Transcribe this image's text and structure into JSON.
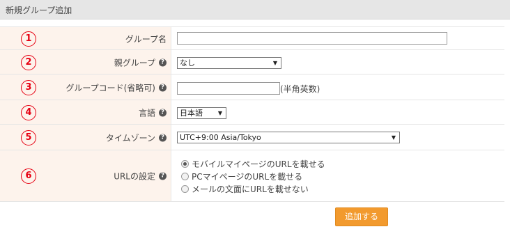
{
  "header": {
    "title": "新規グループ追加"
  },
  "rows": [
    {
      "num": "1",
      "label": "グループ名",
      "help": false,
      "value": ""
    },
    {
      "num": "2",
      "label": "親グループ",
      "help": true,
      "selected": "なし"
    },
    {
      "num": "3",
      "label": "グループコード(省略可)",
      "help": true,
      "value": "",
      "suffix": "(半角英数)"
    },
    {
      "num": "4",
      "label": "言語",
      "help": true,
      "selected": "日本語"
    },
    {
      "num": "5",
      "label": "タイムゾーン",
      "help": true,
      "selected": "UTC+9:00 Asia/Tokyo"
    },
    {
      "num": "6",
      "label": "URLの設定",
      "help": true,
      "options": [
        {
          "text": "モバイルマイページのURLを載せる",
          "checked": true
        },
        {
          "text": "PCマイページのURLを載せる",
          "checked": false
        },
        {
          "text": "メールの文面にURLを載せない",
          "checked": false
        }
      ]
    }
  ],
  "help_icon": "question-circle-icon",
  "submit_label": "追加する",
  "colors": {
    "accent": "#f29a2e",
    "number": "#e60012",
    "label_bg": "#fdf3ec"
  }
}
